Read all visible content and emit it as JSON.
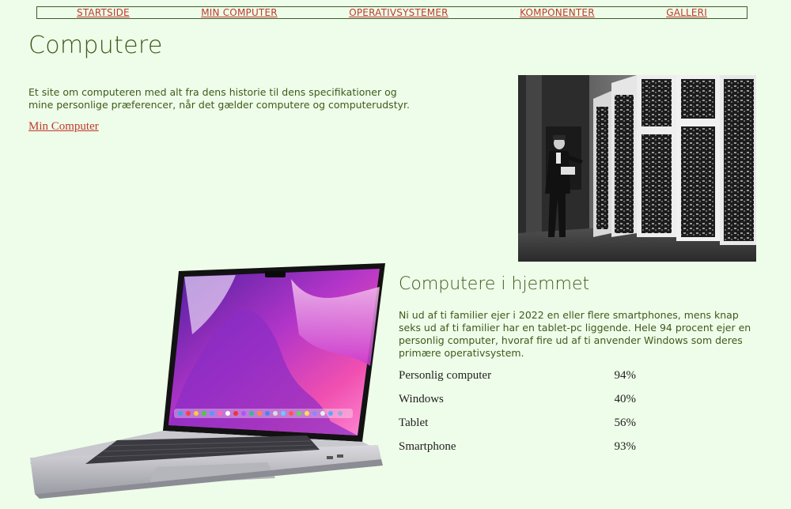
{
  "nav": {
    "items": [
      {
        "label": "STARTSIDE"
      },
      {
        "label": "MIN COMPUTER"
      },
      {
        "label": "OPERATIVSYSTEMER"
      },
      {
        "label": "KOMPONENTER"
      },
      {
        "label": "GALLERI"
      }
    ]
  },
  "hero": {
    "title": "Computere",
    "intro": "Et site om computeren med alt fra dens historie til dens specifikationer og mine personlige præferencer, når det gælder computere og computerudstyr.",
    "link": "Min Computer"
  },
  "home": {
    "heading": "Computere i hjemmet",
    "paragraph": "Ni ud af ti familier ejer i 2022 en eller flere smartphones, mens knap seks ud af ti familier har en tablet-pc liggende. Hele 94 procent ejer en personlig computer, hvoraf fire ud af ti anvender Windows som deres primære operativsystem.",
    "stats": [
      {
        "label": "Personlig computer",
        "value": "94%"
      },
      {
        "label": "Windows",
        "value": "40%"
      },
      {
        "label": "Tablet",
        "value": "56%"
      },
      {
        "label": "Smartphone",
        "value": "93%"
      }
    ]
  },
  "colors": {
    "background": "#eefde9",
    "link": "#c0392b",
    "text": "#3d5a1a"
  }
}
